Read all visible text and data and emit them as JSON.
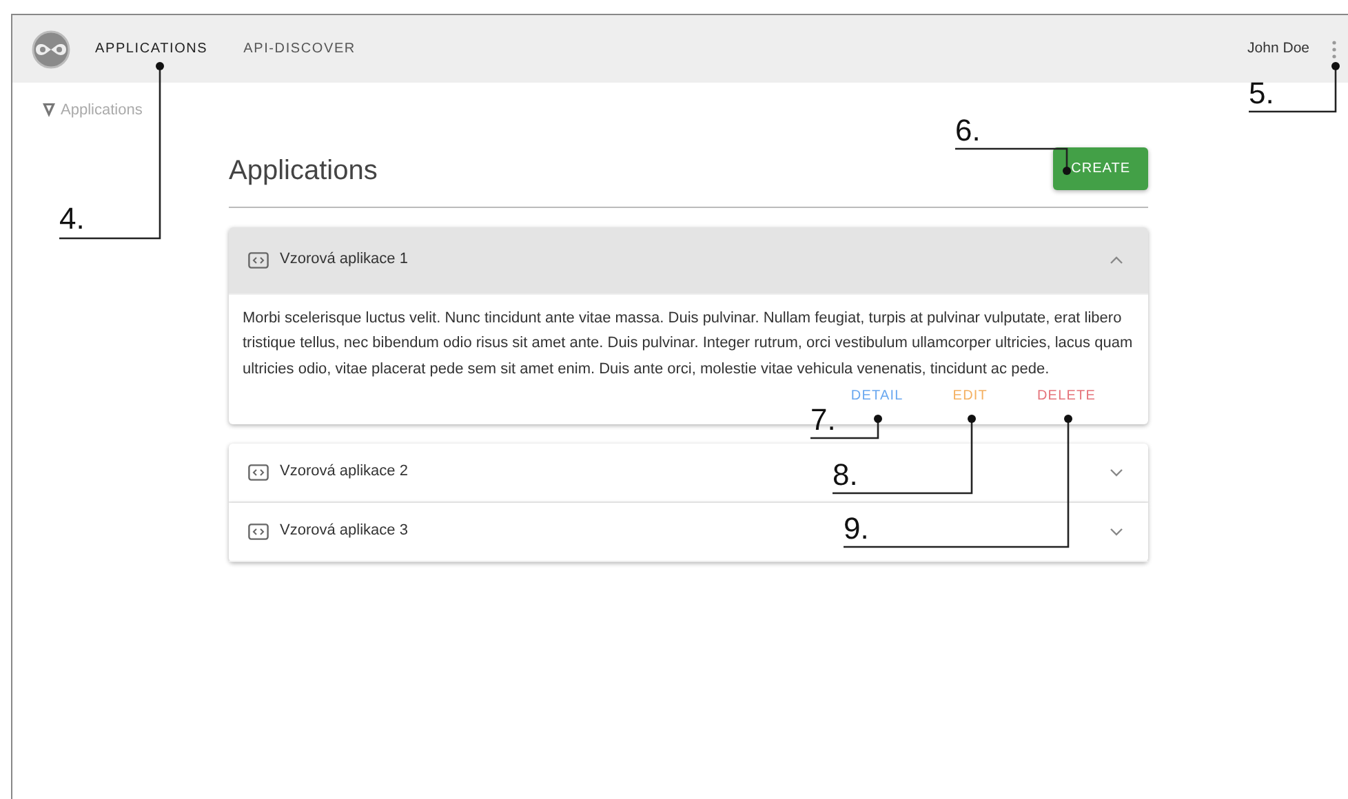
{
  "navbar": {
    "tabs": [
      {
        "label": "APPLICATIONS",
        "selected": true
      },
      {
        "label": "API-DISCOVER",
        "selected": false
      }
    ],
    "user": "John Doe"
  },
  "breadcrumb": "Applications",
  "page": {
    "title": "Applications",
    "create_button": "CREATE"
  },
  "applications": [
    {
      "name": "Vzorová aplikace 1",
      "expanded": true,
      "description": "Morbi scelerisque luctus velit. Nunc tincidunt ante vitae massa. Duis pulvinar. Nullam feugiat, turpis at pulvinar vulputate, erat libero tristique tellus, nec bibendum odio risus sit amet ante. Duis pulvinar. Integer rutrum, orci vestibulum ullamcorper ultricies, lacus quam ultricies odio, vitae placerat pede sem sit amet enim. Duis ante orci, molestie vitae vehicula venenatis, tincidunt ac pede.",
      "actions": [
        {
          "label": "DETAIL",
          "kind": "detail"
        },
        {
          "label": "EDIT",
          "kind": "edit"
        },
        {
          "label": "DELETE",
          "kind": "delete"
        }
      ]
    },
    {
      "name": "Vzorová aplikace 2",
      "expanded": false
    },
    {
      "name": "Vzorová aplikace 3",
      "expanded": false
    }
  ],
  "callouts": [
    {
      "label": "4."
    },
    {
      "label": "5."
    },
    {
      "label": "6."
    },
    {
      "label": "7."
    },
    {
      "label": "8."
    },
    {
      "label": "9."
    }
  ]
}
